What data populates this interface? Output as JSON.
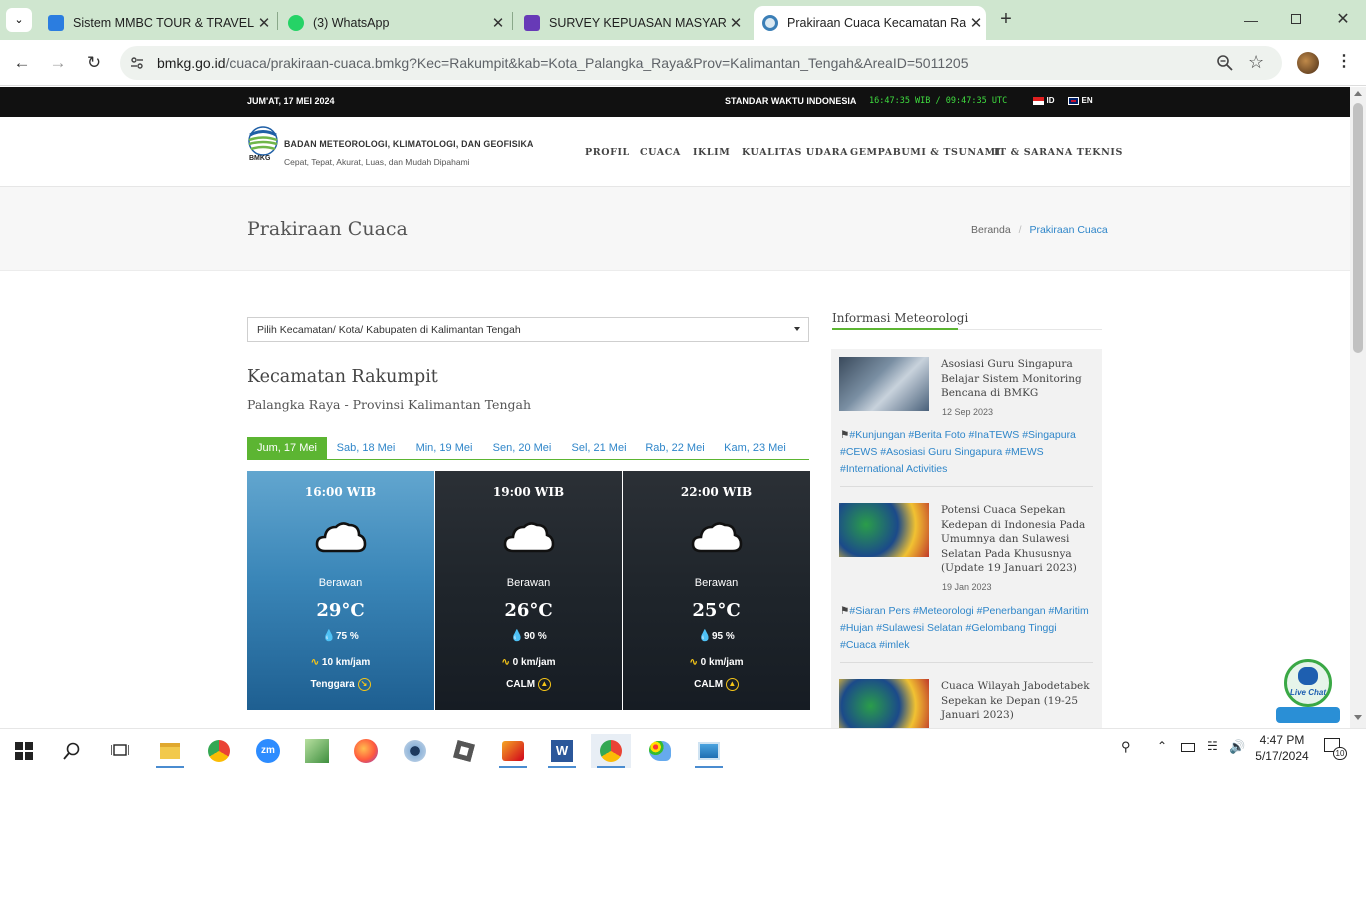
{
  "browser": {
    "tabs": [
      {
        "title": "Sistem MMBC TOUR & TRAVEL",
        "icon": "search-icon"
      },
      {
        "title": "(3) WhatsApp",
        "icon": "whatsapp-icon"
      },
      {
        "title": "SURVEY KEPUASAN MASYARAKAT",
        "icon": "forms-icon"
      },
      {
        "title": "Prakiraan Cuaca Kecamatan Rakumpit",
        "icon": "bmkg-icon"
      }
    ],
    "url_host": "bmkg.go.id",
    "url_path": "/cuaca/prakiraan-cuaca.bmkg?Kec=Rakumpit&kab=Kota_Palangka_Raya&Prov=Kalimantan_Tengah&AreaID=5011205"
  },
  "topbar": {
    "date": "JUM'AT, 17 MEI 2024",
    "time_label": "STANDAR WAKTU INDONESIA",
    "wib": "16:47:35 WIB",
    "sep": "/",
    "utc": "09:47:35 UTC",
    "lang_id": "ID",
    "lang_en": "EN"
  },
  "header": {
    "org_name": "BADAN METEOROLOGI, KLIMATOLOGI, DAN GEOFISIKA",
    "tagline": "Cepat, Tepat, Akurat, Luas, dan Mudah Dipahami",
    "logo_text": "BMKG",
    "menu": [
      "PROFIL",
      "CUACA",
      "IKLIM",
      "KUALITAS UDARA",
      "GEMPABUMI & TSUNAMI",
      "IT & SARANA TEKNIS"
    ]
  },
  "titlebar": {
    "title": "Prakiraan Cuaca",
    "breadcrumb_home": "Beranda",
    "breadcrumb_sep": "/",
    "breadcrumb_current": "Prakiraan Cuaca"
  },
  "forecast": {
    "select_placeholder": "Pilih Kecamatan/ Kota/ Kabupaten di Kalimantan Tengah",
    "heading": "Kecamatan Rakumpit",
    "subheading": "Palangka Raya - Provinsi Kalimantan Tengah",
    "days": [
      "Jum, 17 Mei",
      "Sab, 18 Mei",
      "Min, 19 Mei",
      "Sen, 20 Mei",
      "Sel, 21 Mei",
      "Rab, 22 Mei",
      "Kam, 23 Mei"
    ],
    "cards": [
      {
        "time": "16:00 WIB",
        "condition": "Berawan",
        "temp": "29°C",
        "humidity": "75 %",
        "wind": "10 km/jam",
        "direction": "Tenggara"
      },
      {
        "time": "19:00 WIB",
        "condition": "Berawan",
        "temp": "26°C",
        "humidity": "90 %",
        "wind": "0 km/jam",
        "direction": "CALM"
      },
      {
        "time": "22:00 WIB",
        "condition": "Berawan",
        "temp": "25°C",
        "humidity": "95 %",
        "wind": "0 km/jam",
        "direction": "CALM"
      }
    ]
  },
  "sidebar": {
    "title": "Informasi Meteorologi",
    "news": [
      {
        "title": "Asosiasi Guru Singapura Belajar Sistem Monitoring Bencana di BMKG",
        "date": "12 Sep 2023",
        "tags": "#Kunjungan #Berita Foto #InaTEWS #Singapura #CEWS #Asosiasi Guru Singapura #MEWS #International Activities"
      },
      {
        "title": "Potensi Cuaca Sepekan Kedepan di Indonesia Pada Umumnya dan Sulawesi Selatan Pada Khususnya (Update 19 Januari 2023)",
        "date": "19 Jan 2023",
        "tags": "#Siaran Pers #Meteorologi #Penerbangan #Maritim #Hujan #Sulawesi Selatan #Gelombang Tinggi #Cuaca #imlek"
      },
      {
        "title": "Cuaca Wilayah Jabodetabek Sepekan ke Depan (19-25 Januari 2023)",
        "date": "",
        "tags": ""
      }
    ],
    "livechat": "Live Chat"
  },
  "taskbar": {
    "time": "4:47 PM",
    "date": "5/17/2024",
    "notifications": "10"
  }
}
